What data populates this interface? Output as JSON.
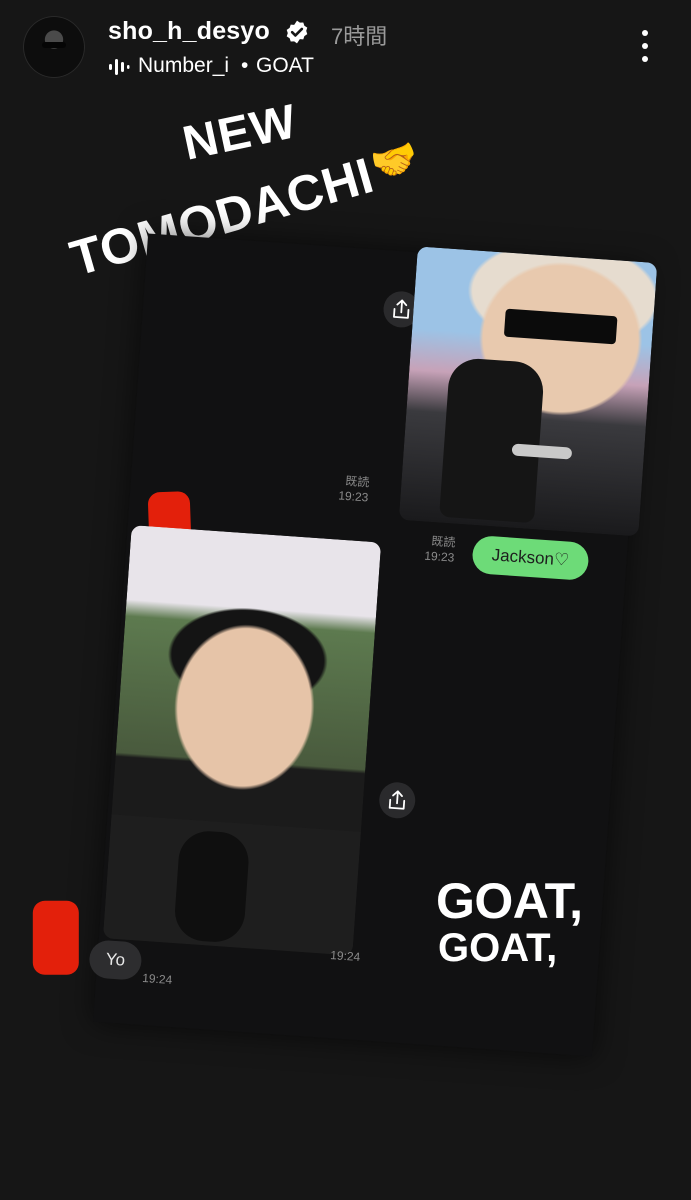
{
  "header": {
    "username": "sho_h_desyo",
    "time": "7時間",
    "music_artist": "Number_i",
    "music_separator": "•",
    "music_song": "GOAT",
    "icons": [
      "verified-icon",
      "music-bars-icon",
      "more-vertical-icon"
    ]
  },
  "sticker": {
    "line1": "NEW",
    "line2": "TOMODACHI",
    "emoji": "🤝"
  },
  "chat": {
    "msg1": {
      "read": "既読",
      "time": "19:23"
    },
    "msg2": {
      "read": "既読",
      "time": "19:23",
      "text": "Jackson♡"
    },
    "msg3": {
      "time": "19:24"
    },
    "msg4": {
      "text": "Yo",
      "time": "19:24"
    },
    "share_icon": "share-icon",
    "accent": "#6ddb78",
    "redaction_color": "#e3200b"
  },
  "overlay": {
    "goat1": "GOAT,",
    "goat2": "GOAT,"
  }
}
